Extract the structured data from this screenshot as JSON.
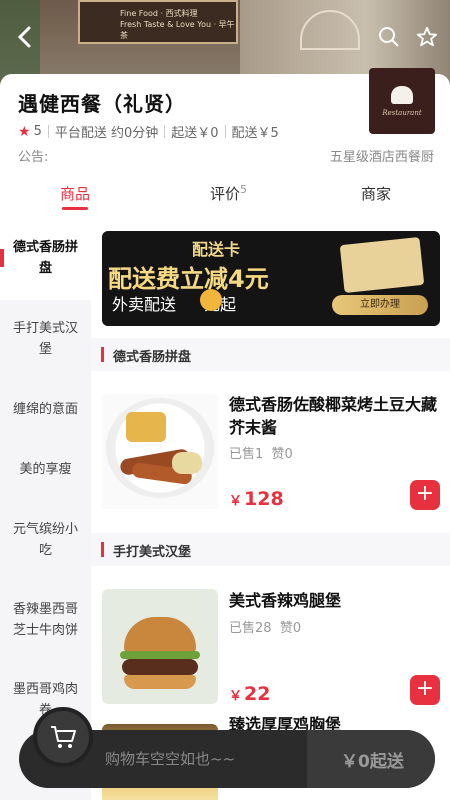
{
  "header": {
    "sign_line1": "Fine Food · 西式料理",
    "sign_line2": "Fresh Taste & Love You · 早午茶",
    "back_icon": "chevron-left-icon",
    "search_icon": "search-icon",
    "favorite_icon": "star-outline-icon"
  },
  "store": {
    "name": "遇健西餐（礼贤）",
    "rating": "5",
    "delivery": "平台配送 约0分钟",
    "min_order": "起送￥0",
    "delivery_fee": "配送￥5",
    "notice_label": "公告:",
    "notice_text": "五星级酒店西餐厨 ",
    "logo_text": "Restaurant"
  },
  "tabs": [
    {
      "label": "商品",
      "active": true
    },
    {
      "label": "评价",
      "count": "5"
    },
    {
      "label": "商家"
    }
  ],
  "sidebar": [
    {
      "label": "德式香肠拼盘",
      "active": true
    },
    {
      "label": "手打美式汉堡"
    },
    {
      "label": "缠绵的意面"
    },
    {
      "label": "美的享瘦"
    },
    {
      "label": "元气缤纷小吃"
    },
    {
      "label": "香辣墨西哥芝士牛肉饼"
    },
    {
      "label": "墨西哥鸡肉卷"
    }
  ],
  "banner": {
    "title": "配送卡",
    "headline": "配送费立减4元",
    "sub_a": "外卖配送",
    "sub_b": "元起",
    "button": "立即办理"
  },
  "sections": [
    {
      "title": "德式香肠拼盘",
      "dishes": [
        {
          "name": "德式香肠佐酸椰菜烤土豆大藏芥末酱",
          "sold": "已售1",
          "likes": "赞0",
          "currency": "￥",
          "price": "128"
        }
      ]
    },
    {
      "title": "手打美式汉堡",
      "dishes": [
        {
          "name": "美式香辣鸡腿堡",
          "sold": "已售28",
          "likes": "赞0",
          "currency": "￥",
          "price": "22"
        },
        {
          "name": "臻选厚厚鸡胸堡"
        }
      ]
    }
  ],
  "cart": {
    "empty_text": "购物车空空如也~~",
    "send_label": "￥0起送"
  },
  "colors": {
    "accent": "#e8313f",
    "cart_bg": "#2b2b2b"
  }
}
